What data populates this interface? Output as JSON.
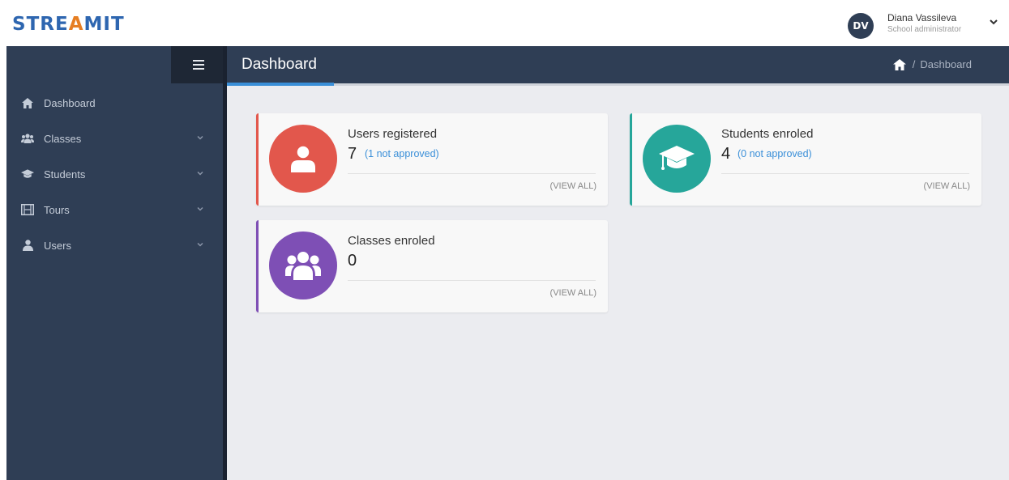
{
  "app": {
    "logo_left": "STRE",
    "logo_mid": "A",
    "logo_right": "MIT"
  },
  "user": {
    "initials": "DV",
    "name": "Diana Vassileva",
    "role": "School administrator"
  },
  "sidebar": {
    "items": [
      {
        "label": "Dashboard",
        "icon": "home-icon"
      },
      {
        "label": "Classes",
        "icon": "users-icon"
      },
      {
        "label": "Students",
        "icon": "graduation-cap-icon"
      },
      {
        "label": "Tours",
        "icon": "film-icon"
      },
      {
        "label": "Users",
        "icon": "user-icon"
      }
    ]
  },
  "header": {
    "title": "Dashboard",
    "breadcrumb_sep": "/",
    "breadcrumb_current": "Dashboard"
  },
  "cards": [
    {
      "title": "Users registered",
      "value": "7",
      "note": "(1 not approved)",
      "view_all": "(VIEW ALL)",
      "color": "#e2574c"
    },
    {
      "title": "Students enroled",
      "value": "4",
      "note": "(0 not approved)",
      "view_all": "(VIEW ALL)",
      "color": "#26a69a"
    },
    {
      "title": "Classes enroled",
      "value": "0",
      "note": "",
      "view_all": "(VIEW ALL)",
      "color": "#7e4fb5"
    }
  ],
  "colors": {
    "sidebar_bg": "#2f3e55",
    "accent_blue": "#3a8fd8",
    "content_bg": "#ebecf0"
  }
}
